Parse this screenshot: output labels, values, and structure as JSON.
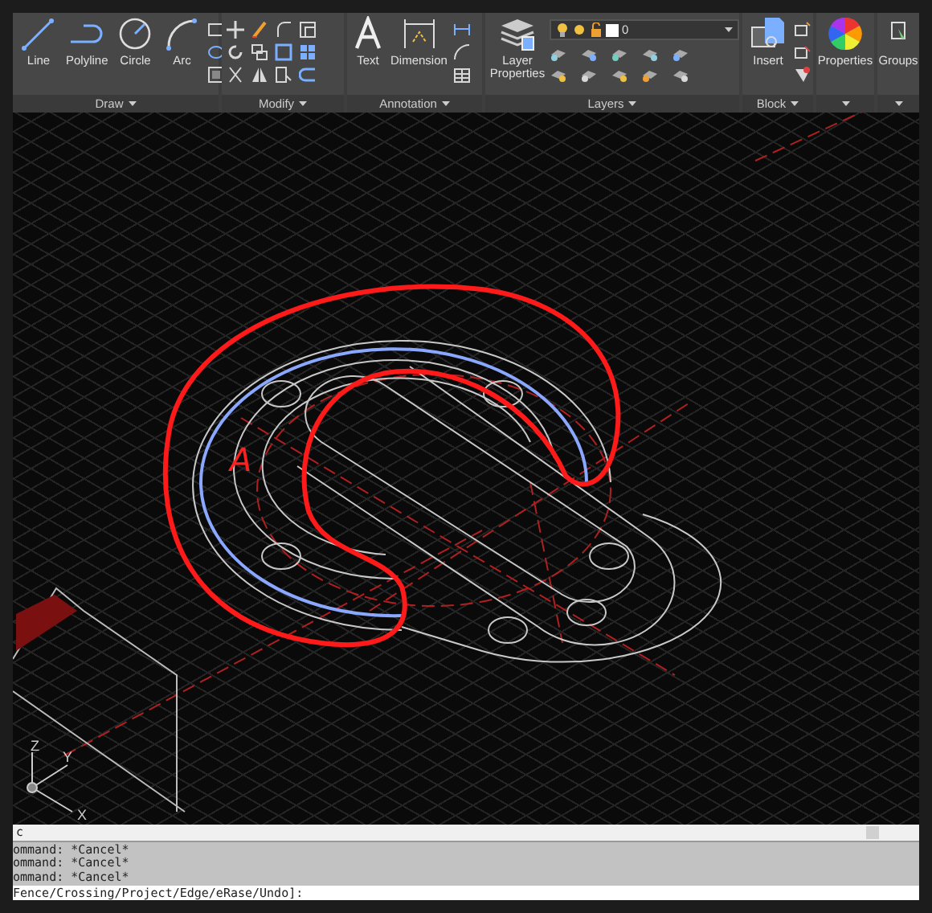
{
  "ribbon": {
    "panels": [
      {
        "kind": "draw",
        "title": "Draw",
        "tools": [
          {
            "label": "Line"
          },
          {
            "label": "Polyline"
          },
          {
            "label": "Circle"
          },
          {
            "label": "Arc"
          }
        ]
      },
      {
        "kind": "modify",
        "title": "Modify"
      },
      {
        "kind": "annotation",
        "title": "Annotation",
        "tools": [
          {
            "label": "Text"
          },
          {
            "label": "Dimension"
          }
        ]
      },
      {
        "kind": "layers",
        "title": "Layers",
        "tools": [
          {
            "label": "Layer Properties"
          }
        ],
        "layer_value": "0"
      },
      {
        "kind": "block",
        "title": "Block",
        "tools": [
          {
            "label": "Insert"
          }
        ]
      },
      {
        "kind": "properties",
        "tools": [
          {
            "label": "Properties"
          }
        ]
      },
      {
        "kind": "groups",
        "tools": [
          {
            "label": "Groups"
          }
        ]
      }
    ]
  },
  "canvas": {
    "markup_letter": "A",
    "ucs_labels": [
      "Z",
      "Y",
      "X"
    ]
  },
  "command_line": {
    "input": "c",
    "history": [
      "ommand: *Cancel*",
      "ommand: *Cancel*",
      "ommand: *Cancel*"
    ],
    "prompt": "Fence/Crossing/Project/Edge/eRase/Undo]:"
  }
}
